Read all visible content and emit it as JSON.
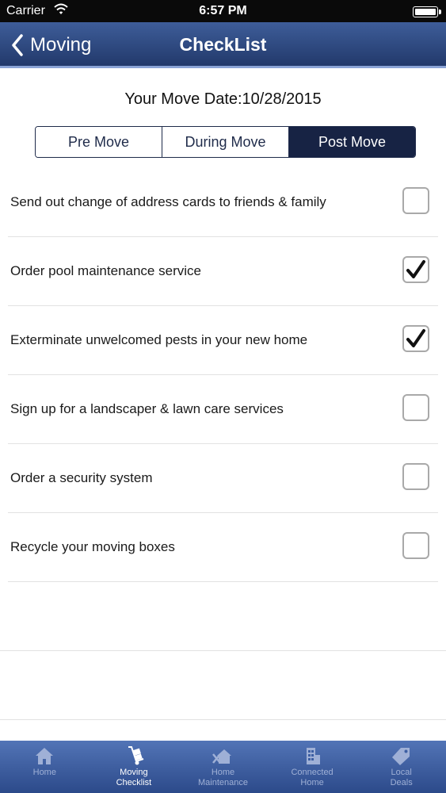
{
  "status_bar": {
    "carrier": "Carrier",
    "time": "6:57 PM"
  },
  "navbar": {
    "back_label": "Moving",
    "title": "CheckList"
  },
  "move_date": "Your Move Date:10/28/2015",
  "segments": [
    {
      "label": "Pre Move",
      "active": false
    },
    {
      "label": "During Move",
      "active": false
    },
    {
      "label": "Post Move",
      "active": true
    }
  ],
  "checklist": [
    {
      "text": "Send out change of address cards to friends & family",
      "checked": false
    },
    {
      "text": "Order pool maintenance service",
      "checked": true
    },
    {
      "text": "Exterminate unwelcomed pests in your new home",
      "checked": true
    },
    {
      "text": "Sign up for a landscaper & lawn care services",
      "checked": false
    },
    {
      "text": "Order a security system",
      "checked": false
    },
    {
      "text": "Recycle your moving boxes",
      "checked": false
    }
  ],
  "tabs": [
    {
      "line1": "Home",
      "line2": "",
      "icon": "home-icon",
      "active": false
    },
    {
      "line1": "Moving",
      "line2": "Checklist",
      "icon": "hand-truck-icon",
      "active": true
    },
    {
      "line1": "Home",
      "line2": "Maintenance",
      "icon": "tools-house-icon",
      "active": false
    },
    {
      "line1": "Connected",
      "line2": "Home",
      "icon": "building-icon",
      "active": false
    },
    {
      "line1": "Local",
      "line2": "Deals",
      "icon": "tag-icon",
      "active": false
    }
  ],
  "colors": {
    "navbar_top": "#3e5d99",
    "navbar_bottom": "#22396b",
    "segment_active": "#172344",
    "tabbar": "#3d5fa3",
    "tab_inactive": "#9fb0d6"
  }
}
